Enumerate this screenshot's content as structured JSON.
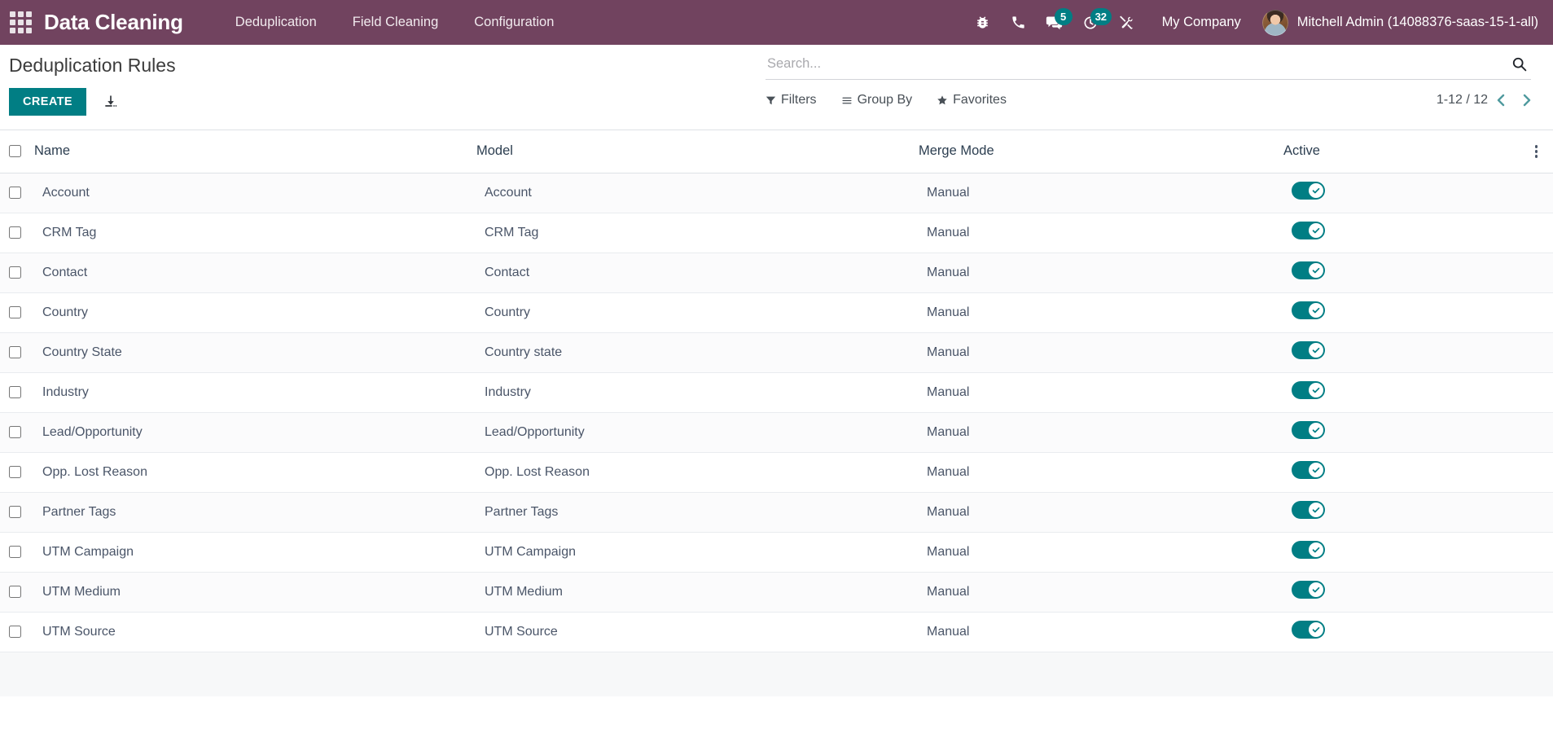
{
  "navbar": {
    "apps_icon": "apps-grid-icon",
    "brand": "Data Cleaning",
    "menu": [
      {
        "label": "Deduplication"
      },
      {
        "label": "Field Cleaning"
      },
      {
        "label": "Configuration"
      }
    ],
    "systray": [
      {
        "icon": "bug-icon",
        "badge": null
      },
      {
        "icon": "phone-icon",
        "badge": null
      },
      {
        "icon": "messages-icon",
        "badge": "5"
      },
      {
        "icon": "activities-clock-icon",
        "badge": "32"
      },
      {
        "icon": "tools-icon",
        "badge": null
      }
    ],
    "company": "My Company",
    "user": "Mitchell Admin (14088376-saas-15-1-all)",
    "avatar_icon": "user-avatar"
  },
  "control_panel": {
    "breadcrumb": "Deduplication Rules",
    "create_label": "CREATE",
    "import_icon": "import-download-icon",
    "search": {
      "placeholder": "Search...",
      "value": "",
      "search_icon": "search-icon"
    },
    "filters": [
      {
        "label": "Filters",
        "icon": "funnel-icon"
      },
      {
        "label": "Group By",
        "icon": "bars-icon"
      },
      {
        "label": "Favorites",
        "icon": "star-icon"
      }
    ],
    "pager": {
      "value": "1-12 / 12",
      "prev_icon": "chevron-left-icon",
      "next_icon": "chevron-right-icon"
    }
  },
  "table": {
    "columns": [
      "Name",
      "Model",
      "Merge Mode",
      "Active"
    ],
    "options_icon": "vertical-dots-icon",
    "rows": [
      {
        "name": "Account",
        "model": "Account",
        "merge_mode": "Manual",
        "active": true
      },
      {
        "name": "CRM Tag",
        "model": "CRM Tag",
        "merge_mode": "Manual",
        "active": true
      },
      {
        "name": "Contact",
        "model": "Contact",
        "merge_mode": "Manual",
        "active": true
      },
      {
        "name": "Country",
        "model": "Country",
        "merge_mode": "Manual",
        "active": true
      },
      {
        "name": "Country State",
        "model": "Country state",
        "merge_mode": "Manual",
        "active": true
      },
      {
        "name": "Industry",
        "model": "Industry",
        "merge_mode": "Manual",
        "active": true
      },
      {
        "name": "Lead/Opportunity",
        "model": "Lead/Opportunity",
        "merge_mode": "Manual",
        "active": true
      },
      {
        "name": "Opp. Lost Reason",
        "model": "Opp. Lost Reason",
        "merge_mode": "Manual",
        "active": true
      },
      {
        "name": "Partner Tags",
        "model": "Partner Tags",
        "merge_mode": "Manual",
        "active": true
      },
      {
        "name": "UTM Campaign",
        "model": "UTM Campaign",
        "merge_mode": "Manual",
        "active": true
      },
      {
        "name": "UTM Medium",
        "model": "UTM Medium",
        "merge_mode": "Manual",
        "active": true
      },
      {
        "name": "UTM Source",
        "model": "UTM Source",
        "merge_mode": "Manual",
        "active": true
      }
    ]
  },
  "colors": {
    "navbar": "#71435f",
    "accent": "#017e84",
    "badge": "#017e84",
    "row_border": "#e9ecef"
  }
}
